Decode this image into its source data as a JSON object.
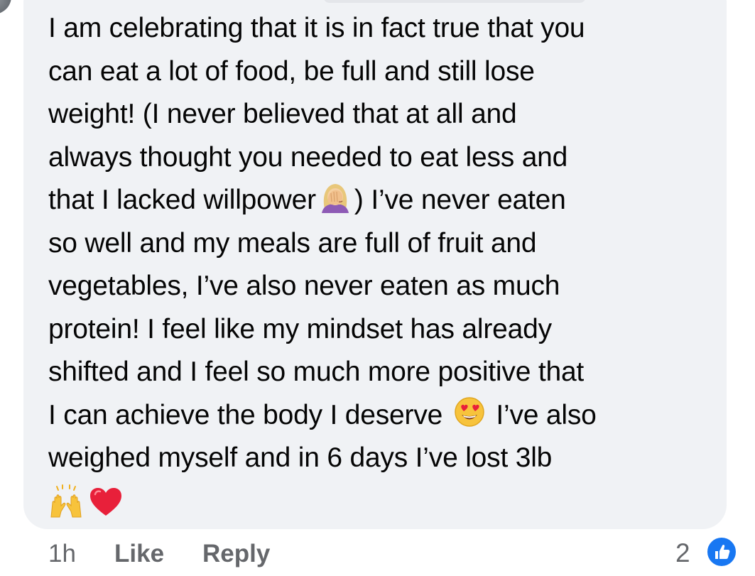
{
  "comment": {
    "lines": [
      "I am celebrating that it is in fact true that you",
      "can eat a lot of food, be full and still lose",
      "weight! (I never believed that at all and",
      "always thought you needed to eat less and",
      "that I lacked willpower",
      ") I’ve never eaten",
      "so well and my meals are full of fruit and",
      "vegetables, I’ve also never eaten as much",
      "protein! I feel like my mindset has already",
      "shifted and I feel so much more positive that",
      "I can achieve the body I deserve",
      "I’ve also",
      "weighed myself and in 6 days I’ve lost 3lb"
    ],
    "emojis": [
      "facepalm-emoji",
      "heart-eyes-emoji",
      "raised-hands-emoji",
      "red-heart-emoji"
    ]
  },
  "actions": {
    "time": "1h",
    "like": "Like",
    "reply": "Reply"
  },
  "reactions": {
    "count": "2",
    "type": "like-icon",
    "color": "#1877f2"
  },
  "colors": {
    "bubble": "#f0f2f5",
    "text": "#050505",
    "meta": "#65676b"
  }
}
